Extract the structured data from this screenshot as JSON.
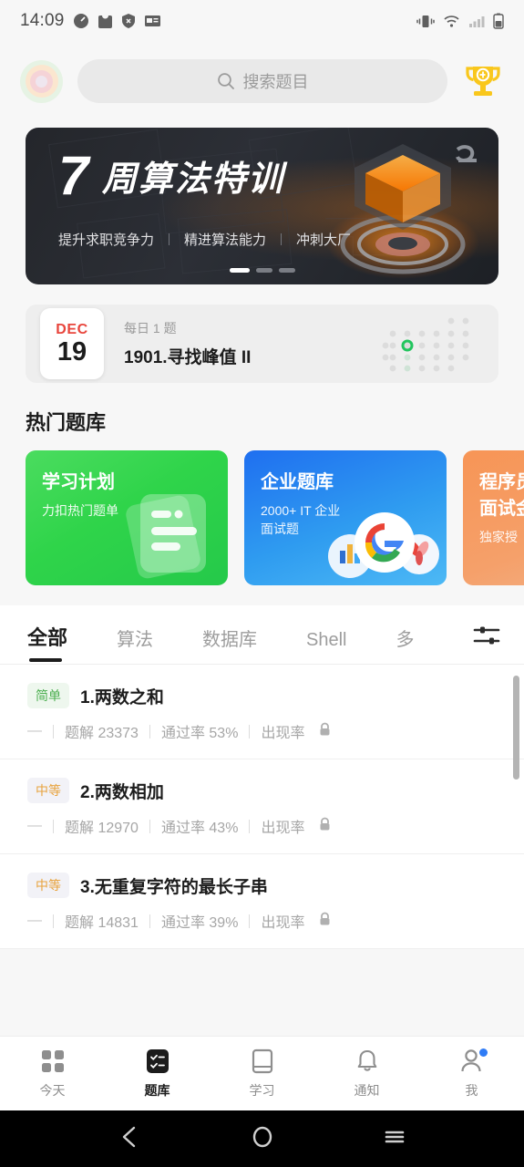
{
  "statusbar": {
    "time": "14:09",
    "left_icons": [
      "speedometer-icon",
      "bag-icon",
      "shield-icon",
      "news-icon"
    ],
    "right_icons": [
      "vibrate-icon",
      "wifi-icon",
      "signal-icon",
      "battery-icon"
    ]
  },
  "header": {
    "avatar_name": "user-avatar",
    "search_placeholder": "搜索题目",
    "trophy_label": "trophy-icon"
  },
  "banner": {
    "number": "7",
    "title": "周算法特训",
    "subs": [
      "提升求职竞争力",
      "精进算法能力",
      "冲刺大厂"
    ],
    "dot_count": 3,
    "active_dot": 0
  },
  "daily": {
    "month": "DEC",
    "day": "19",
    "subtitle": "每日 1 题",
    "problem": "1901.寻找峰值 II"
  },
  "hot": {
    "section_title": "热门题库",
    "cards": [
      {
        "title": "学习计划",
        "sub": "力扣热门题单",
        "color": "#2fd44a",
        "art": "documents-icon"
      },
      {
        "title": "企业题库",
        "sub": "2000+ IT 企业\n面试题",
        "color": "#2f9cf0",
        "art": "company-logos-icon"
      },
      {
        "title": "程序员\n面试金",
        "sub": "独家授",
        "color": "#f5a06a",
        "art": "none"
      }
    ]
  },
  "tabs": {
    "items": [
      "全部",
      "算法",
      "数据库",
      "Shell",
      "多"
    ],
    "active_index": 0,
    "filter_icon": "sliders-icon"
  },
  "problems": [
    {
      "difficulty": "简单",
      "difficulty_level": "easy",
      "title": "1.两数之和",
      "status": "—",
      "solutions_label": "题解 23373",
      "acceptance_label": "通过率 53%",
      "frequency_label": "出现率",
      "frequency_locked": true
    },
    {
      "difficulty": "中等",
      "difficulty_level": "medium",
      "title": "2.两数相加",
      "status": "—",
      "solutions_label": "题解 12970",
      "acceptance_label": "通过率 43%",
      "frequency_label": "出现率",
      "frequency_locked": true
    },
    {
      "difficulty": "中等",
      "difficulty_level": "medium",
      "title": "3.无重复字符的最长子串",
      "status": "—",
      "solutions_label": "题解 14831",
      "acceptance_label": "通过率 39%",
      "frequency_label": "出现率",
      "frequency_locked": true
    }
  ],
  "bottomnav": {
    "items": [
      {
        "label": "今天",
        "icon": "grid-icon",
        "active": false,
        "badge": false
      },
      {
        "label": "题库",
        "icon": "checklist-icon",
        "active": true,
        "badge": false
      },
      {
        "label": "学习",
        "icon": "book-icon",
        "active": false,
        "badge": false
      },
      {
        "label": "通知",
        "icon": "bell-icon",
        "active": false,
        "badge": false
      },
      {
        "label": "我",
        "icon": "person-icon",
        "active": false,
        "badge": true
      }
    ]
  },
  "androidnav": {
    "back": "back-icon",
    "home": "home-icon",
    "recents": "recents-icon"
  },
  "colors": {
    "accent_orange": "#ff8a00",
    "easy_green": "#4caf50",
    "medium_orange": "#e8a33d",
    "badge_blue": "#2f7cf6",
    "calendar_red": "#e8453c"
  }
}
